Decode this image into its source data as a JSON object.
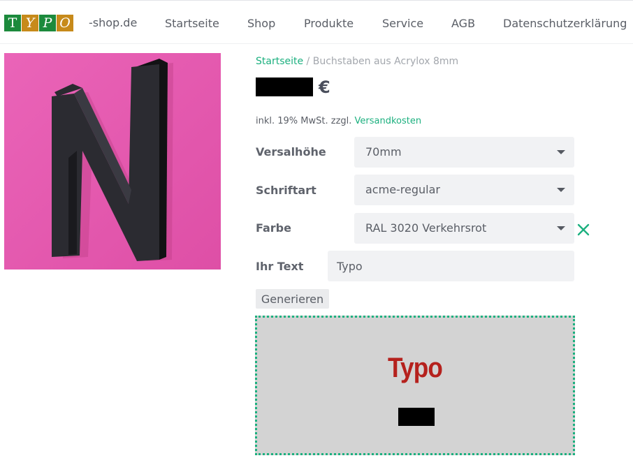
{
  "header": {
    "logo_letters": [
      "T",
      "Y",
      "P",
      "O"
    ],
    "logo_suffix": "-shop.de",
    "nav": [
      "Startseite",
      "Shop",
      "Produkte",
      "Service",
      "AGB",
      "Datenschutzerklärung"
    ]
  },
  "breadcrumb": {
    "home": "Startseite",
    "separator": " / ",
    "current": "Buchstaben aus Acrylox 8mm"
  },
  "price": {
    "currency": "€"
  },
  "tax": {
    "text": "inkl. 19% MwSt. zzgl. ",
    "link": "Versandkosten"
  },
  "form": {
    "versalhoehe": {
      "label": "Versalhöhe",
      "value": "70mm"
    },
    "schriftart": {
      "label": "Schriftart",
      "value": "acme-regular"
    },
    "farbe": {
      "label": "Farbe",
      "value": "RAL 3020 Verkehrsrot"
    },
    "text": {
      "label": "Ihr Text",
      "value": "Typo"
    },
    "generate_label": "Generieren"
  },
  "preview": {
    "text": "Typo",
    "text_color": "#b5211d"
  },
  "colors": {
    "accent": "#1cb07f",
    "product_background": "#e45ab0",
    "logo_green": "#1c8a3c",
    "logo_orange": "#c78a1a"
  },
  "icons": {
    "clear": "close-icon",
    "dropdown": "chevron-down-icon"
  }
}
